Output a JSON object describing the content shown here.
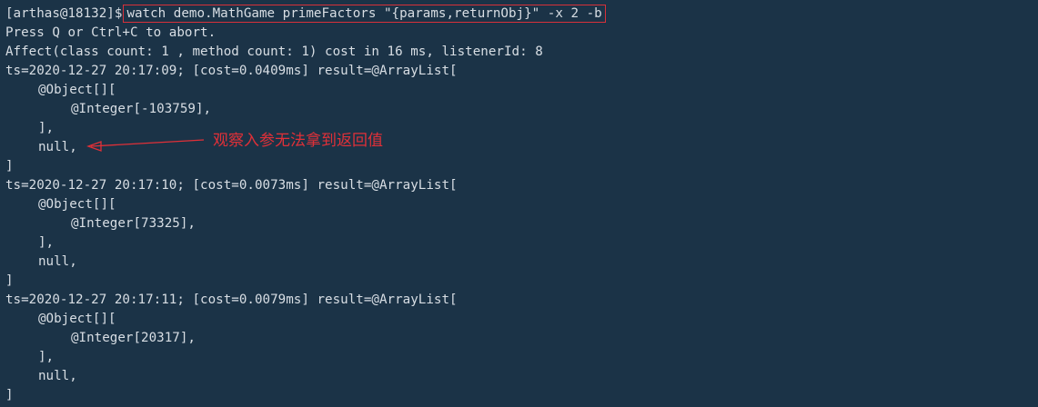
{
  "terminal": {
    "prompt": "[arthas@18132]$",
    "command": "watch demo.MathGame primeFactors \"{params,returnObj}\" -x 2 -b",
    "abort_hint": "Press Q or Ctrl+C to abort.",
    "affect": "Affect(class count: 1 , method count: 1) cost in 16 ms, listenerId: 8",
    "results": [
      {
        "header": "ts=2020-12-27 20:17:09; [cost=0.0409ms] result=@ArrayList[",
        "object_open": "@Object[][",
        "integer": "@Integer[-103759],",
        "object_close": "],",
        "null_line": "null,",
        "close": "]"
      },
      {
        "header": "ts=2020-12-27 20:17:10; [cost=0.0073ms] result=@ArrayList[",
        "object_open": "@Object[][",
        "integer": "@Integer[73325],",
        "object_close": "],",
        "null_line": "null,",
        "close": "]"
      },
      {
        "header": "ts=2020-12-27 20:17:11; [cost=0.0079ms] result=@ArrayList[",
        "object_open": "@Object[][",
        "integer": "@Integer[20317],",
        "object_close": "],",
        "null_line": "null,",
        "close": "]"
      }
    ]
  },
  "annotation": {
    "text": "观察入参无法拿到返回值",
    "color": "#e03038"
  },
  "colors": {
    "background": "#1b3347",
    "foreground": "#d8dee4",
    "highlight": "#d8313a"
  }
}
